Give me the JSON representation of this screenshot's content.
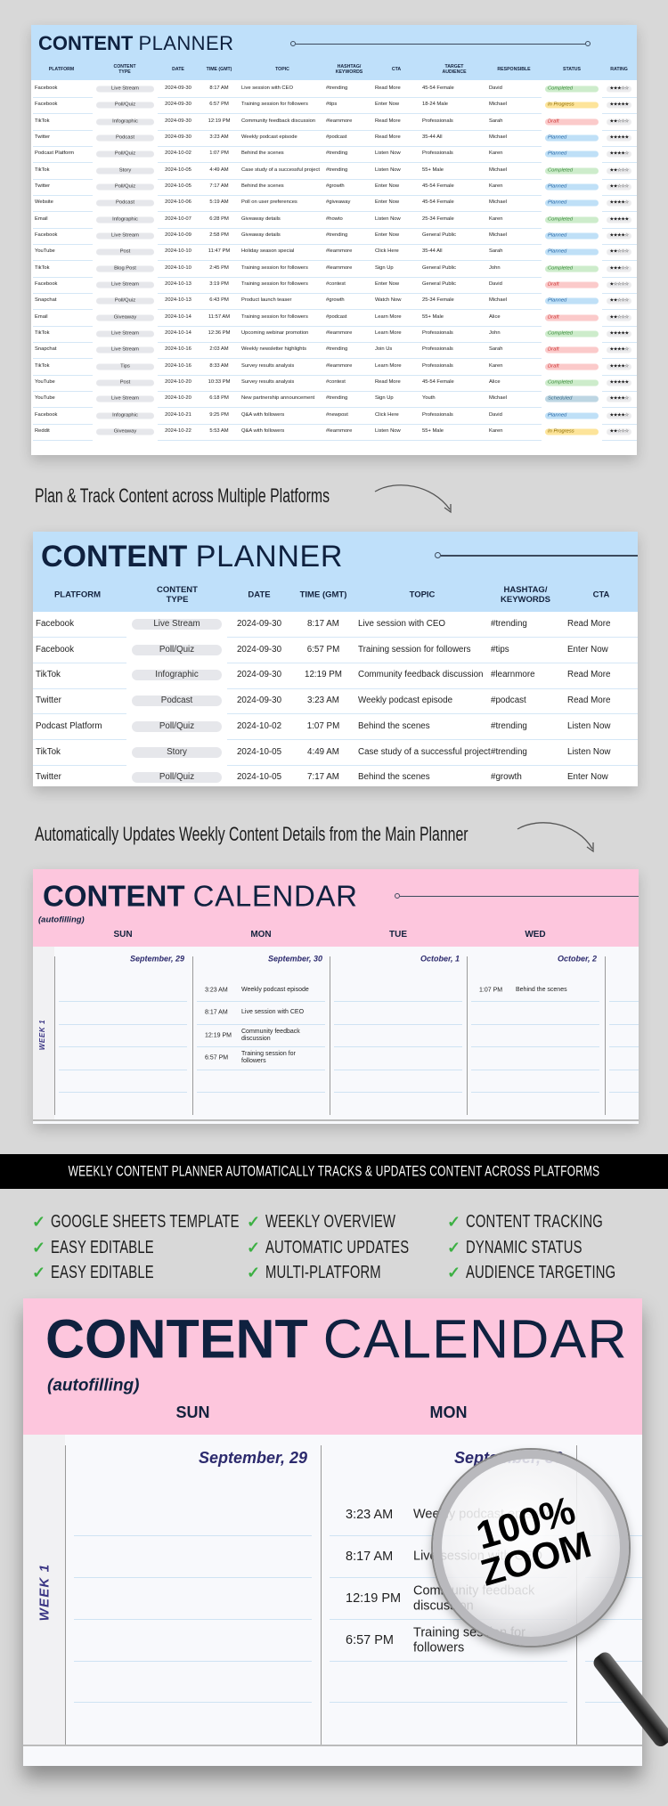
{
  "planner": {
    "title_bold": "CONTENT",
    "title_regular": "PLANNER",
    "columns": [
      "PLATFORM",
      "CONTENT TYPE",
      "DATE",
      "TIME (GMT)",
      "TOPIC",
      "HASHTAG/ KEYWORDS",
      "CTA",
      "TARGET AUDIENCE",
      "RESPONSIBLE",
      "STATUS",
      "RATING"
    ],
    "rows": [
      {
        "platform": "Facebook",
        "type": "Live Stream",
        "date": "2024-09-30",
        "time": "8:17 AM",
        "topic": "Live session with CEO",
        "hashtag": "#trending",
        "cta": "Read More",
        "audience": "45-54 Female",
        "responsible": "David",
        "status": "Completed",
        "rating": 3
      },
      {
        "platform": "Facebook",
        "type": "Poll/Quiz",
        "date": "2024-09-30",
        "time": "6:57 PM",
        "topic": "Training session for followers",
        "hashtag": "#tips",
        "cta": "Enter Now",
        "audience": "18-24 Male",
        "responsible": "Michael",
        "status": "In Progress",
        "rating": 5
      },
      {
        "platform": "TikTok",
        "type": "Infographic",
        "date": "2024-09-30",
        "time": "12:19 PM",
        "topic": "Community feedback discussion",
        "hashtag": "#learnmore",
        "cta": "Read More",
        "audience": "Professionals",
        "responsible": "Sarah",
        "status": "Draft",
        "rating": 2
      },
      {
        "platform": "Twitter",
        "type": "Podcast",
        "date": "2024-09-30",
        "time": "3:23 AM",
        "topic": "Weekly podcast episode",
        "hashtag": "#podcast",
        "cta": "Read More",
        "audience": "35-44 All",
        "responsible": "Michael",
        "status": "Planned",
        "rating": 5
      },
      {
        "platform": "Podcast Platform",
        "type": "Poll/Quiz",
        "date": "2024-10-02",
        "time": "1:07 PM",
        "topic": "Behind the scenes",
        "hashtag": "#trending",
        "cta": "Listen Now",
        "audience": "Professionals",
        "responsible": "Karen",
        "status": "Planned",
        "rating": 4
      },
      {
        "platform": "TikTok",
        "type": "Story",
        "date": "2024-10-05",
        "time": "4:49 AM",
        "topic": "Case study of a successful project",
        "hashtag": "#trending",
        "cta": "Listen Now",
        "audience": "55+ Male",
        "responsible": "Michael",
        "status": "Completed",
        "rating": 2
      },
      {
        "platform": "Twitter",
        "type": "Poll/Quiz",
        "date": "2024-10-05",
        "time": "7:17 AM",
        "topic": "Behind the scenes",
        "hashtag": "#growth",
        "cta": "Enter Now",
        "audience": "45-54 Female",
        "responsible": "Karen",
        "status": "Planned",
        "rating": 2
      },
      {
        "platform": "Website",
        "type": "Podcast",
        "date": "2024-10-06",
        "time": "5:19 AM",
        "topic": "Poll on user preferences",
        "hashtag": "#giveaway",
        "cta": "Enter Now",
        "audience": "45-54 Female",
        "responsible": "Michael",
        "status": "Planned",
        "rating": 4
      },
      {
        "platform": "Email",
        "type": "Infographic",
        "date": "2024-10-07",
        "time": "6:28 PM",
        "topic": "Giveaway details",
        "hashtag": "#howto",
        "cta": "Listen Now",
        "audience": "25-34 Female",
        "responsible": "Karen",
        "status": "Completed",
        "rating": 5
      },
      {
        "platform": "Facebook",
        "type": "Live Stream",
        "date": "2024-10-09",
        "time": "2:58 PM",
        "topic": "Giveaway details",
        "hashtag": "#trending",
        "cta": "Enter Now",
        "audience": "General Public",
        "responsible": "Michael",
        "status": "Planned",
        "rating": 4
      },
      {
        "platform": "YouTube",
        "type": "Post",
        "date": "2024-10-10",
        "time": "11:47 PM",
        "topic": "Holiday season special",
        "hashtag": "#learnmore",
        "cta": "Click Here",
        "audience": "35-44 All",
        "responsible": "Sarah",
        "status": "Planned",
        "rating": 2
      },
      {
        "platform": "TikTok",
        "type": "Blog Post",
        "date": "2024-10-10",
        "time": "2:45 PM",
        "topic": "Training session for followers",
        "hashtag": "#learnmore",
        "cta": "Sign Up",
        "audience": "General Public",
        "responsible": "John",
        "status": "Completed",
        "rating": 3
      },
      {
        "platform": "Facebook",
        "type": "Live Stream",
        "date": "2024-10-13",
        "time": "3:19 PM",
        "topic": "Training session for followers",
        "hashtag": "#contest",
        "cta": "Enter Now",
        "audience": "General Public",
        "responsible": "David",
        "status": "Draft",
        "rating": 1
      },
      {
        "platform": "Snapchat",
        "type": "Poll/Quiz",
        "date": "2024-10-13",
        "time": "6:43 PM",
        "topic": "Product launch teaser",
        "hashtag": "#growth",
        "cta": "Watch Now",
        "audience": "25-34 Female",
        "responsible": "Michael",
        "status": "Planned",
        "rating": 2
      },
      {
        "platform": "Email",
        "type": "Giveaway",
        "date": "2024-10-14",
        "time": "11:57 AM",
        "topic": "Training session for followers",
        "hashtag": "#podcast",
        "cta": "Learn More",
        "audience": "55+ Male",
        "responsible": "Alice",
        "status": "Draft",
        "rating": 2
      },
      {
        "platform": "TikTok",
        "type": "Live Stream",
        "date": "2024-10-14",
        "time": "12:36 PM",
        "topic": "Upcoming webinar promotion",
        "hashtag": "#learnmore",
        "cta": "Learn More",
        "audience": "Professionals",
        "responsible": "John",
        "status": "Completed",
        "rating": 5
      },
      {
        "platform": "Snapchat",
        "type": "Live Stream",
        "date": "2024-10-16",
        "time": "2:03 AM",
        "topic": "Weekly newsletter highlights",
        "hashtag": "#trending",
        "cta": "Join Us",
        "audience": "Professionals",
        "responsible": "Sarah",
        "status": "Draft",
        "rating": 4
      },
      {
        "platform": "TikTok",
        "type": "Tips",
        "date": "2024-10-16",
        "time": "8:33 AM",
        "topic": "Survey results analysis",
        "hashtag": "#learnmore",
        "cta": "Learn More",
        "audience": "Professionals",
        "responsible": "Karen",
        "status": "Draft",
        "rating": 4
      },
      {
        "platform": "YouTube",
        "type": "Post",
        "date": "2024-10-20",
        "time": "10:33 PM",
        "topic": "Survey results analysis",
        "hashtag": "#contest",
        "cta": "Read More",
        "audience": "45-54 Female",
        "responsible": "Alice",
        "status": "Completed",
        "rating": 5
      },
      {
        "platform": "YouTube",
        "type": "Live Stream",
        "date": "2024-10-20",
        "time": "6:18 PM",
        "topic": "New partnership announcement",
        "hashtag": "#trending",
        "cta": "Sign Up",
        "audience": "Youth",
        "responsible": "Michael",
        "status": "Scheduled",
        "rating": 4
      },
      {
        "platform": "Facebook",
        "type": "Infographic",
        "date": "2024-10-21",
        "time": "9:25 PM",
        "topic": "Q&A with followers",
        "hashtag": "#newpost",
        "cta": "Click Here",
        "audience": "Professionals",
        "responsible": "David",
        "status": "Planned",
        "rating": 4
      },
      {
        "platform": "Reddit",
        "type": "Giveaway",
        "date": "2024-10-22",
        "time": "5:53 AM",
        "topic": "Q&A with followers",
        "hashtag": "#learnmore",
        "cta": "Listen Now",
        "audience": "55+ Male",
        "responsible": "Karen",
        "status": "In Progress",
        "rating": 2
      }
    ],
    "rating_max": 5
  },
  "status_colors": {
    "Completed": {
      "bg": "#cdeccb",
      "fg": "#3b8a3b"
    },
    "In Progress": {
      "bg": "#fde49a",
      "fg": "#8a6a00"
    },
    "Draft": {
      "bg": "#fbcaca",
      "fg": "#cc3333"
    },
    "Planned": {
      "bg": "#bfe0f7",
      "fg": "#2a6aa8"
    },
    "Scheduled": {
      "bg": "#bdd6e3",
      "fg": "#3d6e8a"
    }
  },
  "colors": {
    "planner_header": "#bfe0fa",
    "calendar_header": "#fdc6dd",
    "title_navy": "#0f213f",
    "date_indigo": "#2c2a6d",
    "check_green": "#3cb043",
    "banner": "#000000",
    "background": "#d8d8d8"
  },
  "captions": {
    "plan_track": "Plan & Track Content across Multiple Platforms",
    "auto_updates": "Automatically Updates Weekly Content Details from the Main Planner"
  },
  "calendar": {
    "title_bold": "CONTENT",
    "title_regular": "CALENDAR",
    "subtitle": "(autofilling)",
    "week_label": "WEEK 1",
    "days": [
      {
        "name": "SUN",
        "date": "September, 29",
        "entries": []
      },
      {
        "name": "MON",
        "date": "September, 30",
        "entries": [
          {
            "time": "3:23 AM",
            "topic": "Weekly podcast episode"
          },
          {
            "time": "8:17 AM",
            "topic": "Live session with CEO"
          },
          {
            "time": "12:19 PM",
            "topic": "Community feedback discussion"
          },
          {
            "time": "6:57 PM",
            "topic": "Training session for followers"
          }
        ]
      },
      {
        "name": "TUE",
        "date": "October, 1",
        "entries": []
      },
      {
        "name": "WED",
        "date": "October, 2",
        "entries": [
          {
            "time": "1:07 PM",
            "topic": "Behind the scenes"
          }
        ]
      }
    ]
  },
  "banner": {
    "text": "WEEKLY CONTENT PLANNER AUTOMATICALLY TRACKS & UPDATES CONTENT ACROSS PLATFORMS"
  },
  "features": [
    [
      "GOOGLE SHEETS TEMPLATE",
      "EASY EDITABLE",
      "EASY EDITABLE"
    ],
    [
      "WEEKLY OVERVIEW",
      "AUTOMATIC UPDATES",
      "MULTI-PLATFORM"
    ],
    [
      "CONTENT TRACKING",
      "DYNAMIC STATUS",
      "AUDIENCE TARGETING"
    ]
  ],
  "feature_icon": "check-icon",
  "magnifier": {
    "line1": "100%",
    "line2": "ZOOM",
    "icon": "magnifying-glass-icon"
  }
}
